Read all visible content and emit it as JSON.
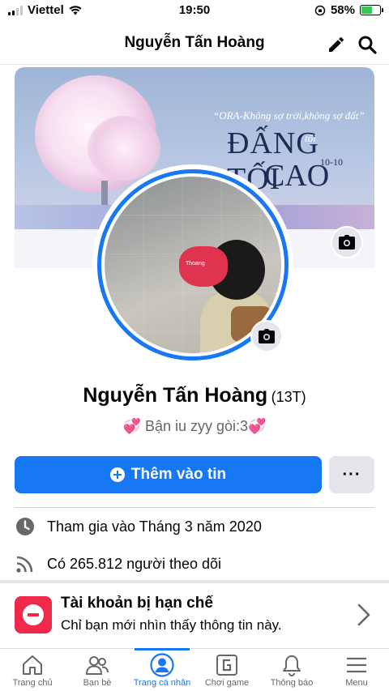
{
  "status_bar": {
    "carrier": "Viettel",
    "time": "19:50",
    "battery_percent": "58%",
    "battery_level": 0.58
  },
  "header": {
    "title": "Nguyễn Tấn Hoàng",
    "icons": [
      "pencil-icon",
      "search-icon"
    ]
  },
  "cover": {
    "quote": "“ORA-Không sợ trời,không sợ đất”",
    "line1": "ĐẤNG TỐI",
    "line1_small": "tối",
    "line2": "CAO",
    "date": "10-10"
  },
  "avatar": {
    "toy_label": "Thoang"
  },
  "profile": {
    "name": "Nguyễn Tấn Hoàng",
    "alternate_name": "(13T)",
    "bio_text": "Bận iu zyy gòi:3",
    "bio_emoji": "💞"
  },
  "actions": {
    "add_story_label": "Thêm vào tin",
    "more_label": "···"
  },
  "details": {
    "joined": "Tham gia vào Tháng 3 năm 2020",
    "followers": "Có 265.812 người theo dõi"
  },
  "restricted": {
    "title": "Tài khoản bị hạn chế",
    "subtitle": "Chỉ bạn mới nhìn thấy thông tin này."
  },
  "bottom_nav": [
    {
      "label": "Trang chủ",
      "icon": "home-icon",
      "active": false
    },
    {
      "label": "Bạn bè",
      "icon": "friends-icon",
      "active": false
    },
    {
      "label": "Trang cá nhân",
      "icon": "profile-icon",
      "active": true
    },
    {
      "label": "Chơi game",
      "icon": "game-icon",
      "active": false
    },
    {
      "label": "Thông báo",
      "icon": "bell-icon",
      "active": false
    },
    {
      "label": "Menu",
      "icon": "menu-icon",
      "active": false
    }
  ],
  "colors": {
    "accent": "#1877f2",
    "restricted": "#f02849",
    "battery": "#34c759"
  }
}
